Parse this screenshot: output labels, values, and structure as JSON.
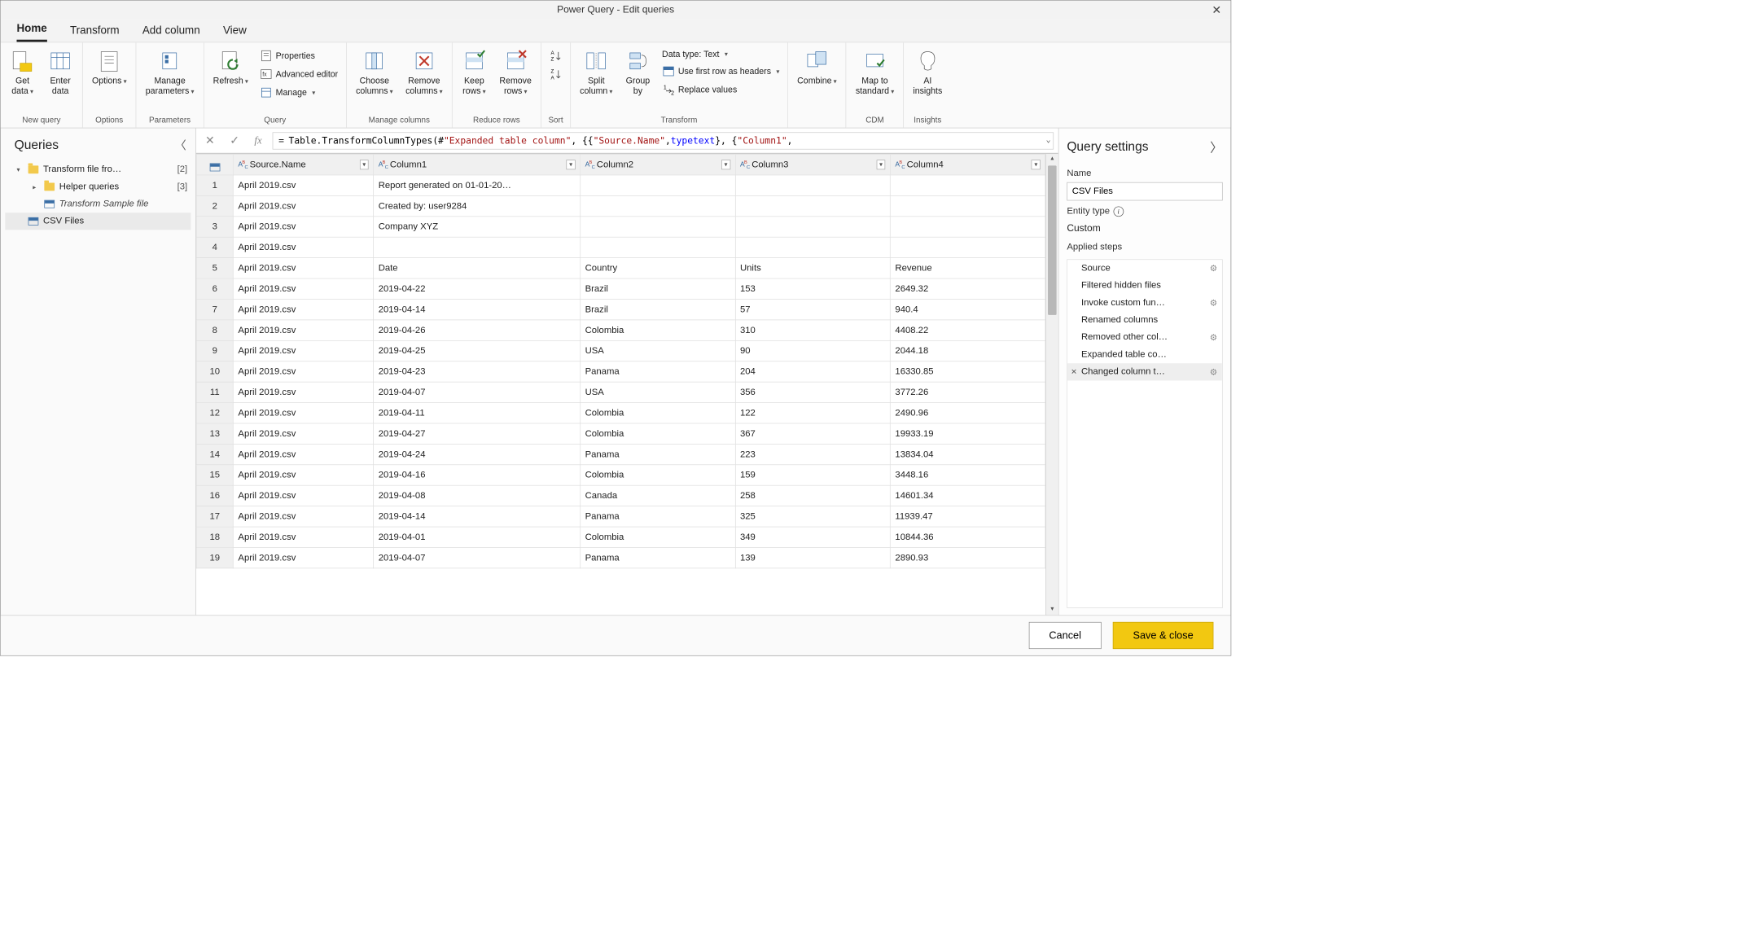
{
  "window": {
    "title": "Power Query - Edit queries"
  },
  "menu": {
    "tabs": [
      "Home",
      "Transform",
      "Add column",
      "View"
    ],
    "active": "Home"
  },
  "ribbon": {
    "groups": {
      "newquery": {
        "label": "New query",
        "get_data": "Get\ndata",
        "enter_data": "Enter\ndata"
      },
      "options": {
        "label": "Options",
        "options": "Options"
      },
      "parameters": {
        "label": "Parameters",
        "manage": "Manage\nparameters"
      },
      "query": {
        "label": "Query",
        "refresh": "Refresh",
        "properties": "Properties",
        "advanced": "Advanced editor",
        "manage": "Manage"
      },
      "managecols": {
        "label": "Manage columns",
        "choose": "Choose\ncolumns",
        "remove": "Remove\ncolumns"
      },
      "reducerows": {
        "label": "Reduce rows",
        "keep": "Keep\nrows",
        "remove": "Remove\nrows"
      },
      "sort": {
        "label": "Sort"
      },
      "transform": {
        "label": "Transform",
        "split": "Split\ncolumn",
        "groupby": "Group\nby",
        "datatype": "Data type: Text",
        "firstrow": "Use first row as headers",
        "replace": "Replace values"
      },
      "combine": {
        "label": "",
        "combine": "Combine"
      },
      "cdm": {
        "label": "CDM",
        "map": "Map to\nstandard"
      },
      "insights": {
        "label": "Insights",
        "ai": "AI\ninsights"
      }
    }
  },
  "formula": {
    "prefix": "Table.TransformColumnTypes(#",
    "str1": "\"Expanded table column\"",
    "mid1": ", {{",
    "str2": "\"Source.Name\"",
    "mid2": ", ",
    "kw": "type",
    "typ": " text",
    "mid3": "}, {",
    "str3": "\"Column1\"",
    "tail": ","
  },
  "queries": {
    "title": "Queries",
    "items": [
      {
        "label": "Transform file fro…",
        "count": "[2]",
        "kind": "folder",
        "level": 0,
        "expand": "▾"
      },
      {
        "label": "Helper queries",
        "count": "[3]",
        "kind": "folder",
        "level": 1,
        "expand": "▸"
      },
      {
        "label": "Transform Sample file",
        "kind": "table",
        "level": 1,
        "italic": true
      },
      {
        "label": "CSV Files",
        "kind": "table",
        "level": 0,
        "selected": true
      }
    ]
  },
  "grid": {
    "columns": [
      "Source.Name",
      "Column1",
      "Column2",
      "Column3",
      "Column4"
    ],
    "rows": [
      [
        "April 2019.csv",
        "Report generated on 01-01-20…",
        "",
        "",
        ""
      ],
      [
        "April 2019.csv",
        "Created by: user9284",
        "",
        "",
        ""
      ],
      [
        "April 2019.csv",
        "Company XYZ",
        "",
        "",
        ""
      ],
      [
        "April 2019.csv",
        "",
        "",
        "",
        ""
      ],
      [
        "April 2019.csv",
        "Date",
        "Country",
        "Units",
        "Revenue"
      ],
      [
        "April 2019.csv",
        "2019-04-22",
        "Brazil",
        "153",
        "2649.32"
      ],
      [
        "April 2019.csv",
        "2019-04-14",
        "Brazil",
        "57",
        "940.4"
      ],
      [
        "April 2019.csv",
        "2019-04-26",
        "Colombia",
        "310",
        "4408.22"
      ],
      [
        "April 2019.csv",
        "2019-04-25",
        "USA",
        "90",
        "2044.18"
      ],
      [
        "April 2019.csv",
        "2019-04-23",
        "Panama",
        "204",
        "16330.85"
      ],
      [
        "April 2019.csv",
        "2019-04-07",
        "USA",
        "356",
        "3772.26"
      ],
      [
        "April 2019.csv",
        "2019-04-11",
        "Colombia",
        "122",
        "2490.96"
      ],
      [
        "April 2019.csv",
        "2019-04-27",
        "Colombia",
        "367",
        "19933.19"
      ],
      [
        "April 2019.csv",
        "2019-04-24",
        "Panama",
        "223",
        "13834.04"
      ],
      [
        "April 2019.csv",
        "2019-04-16",
        "Colombia",
        "159",
        "3448.16"
      ],
      [
        "April 2019.csv",
        "2019-04-08",
        "Canada",
        "258",
        "14601.34"
      ],
      [
        "April 2019.csv",
        "2019-04-14",
        "Panama",
        "325",
        "11939.47"
      ],
      [
        "April 2019.csv",
        "2019-04-01",
        "Colombia",
        "349",
        "10844.36"
      ],
      [
        "April 2019.csv",
        "2019-04-07",
        "Panama",
        "139",
        "2890.93"
      ]
    ]
  },
  "settings": {
    "title": "Query settings",
    "name_label": "Name",
    "name_value": "CSV Files",
    "entity_label": "Entity type",
    "entity_value": "Custom",
    "steps_label": "Applied steps",
    "steps": [
      {
        "label": "Source",
        "gear": true
      },
      {
        "label": "Filtered hidden files"
      },
      {
        "label": "Invoke custom fun…",
        "gear": true
      },
      {
        "label": "Renamed columns"
      },
      {
        "label": "Removed other col…",
        "gear": true
      },
      {
        "label": "Expanded table co…"
      },
      {
        "label": "Changed column t…",
        "gear": true,
        "selected": true,
        "x": true
      }
    ]
  },
  "footer": {
    "cancel": "Cancel",
    "save": "Save & close"
  }
}
